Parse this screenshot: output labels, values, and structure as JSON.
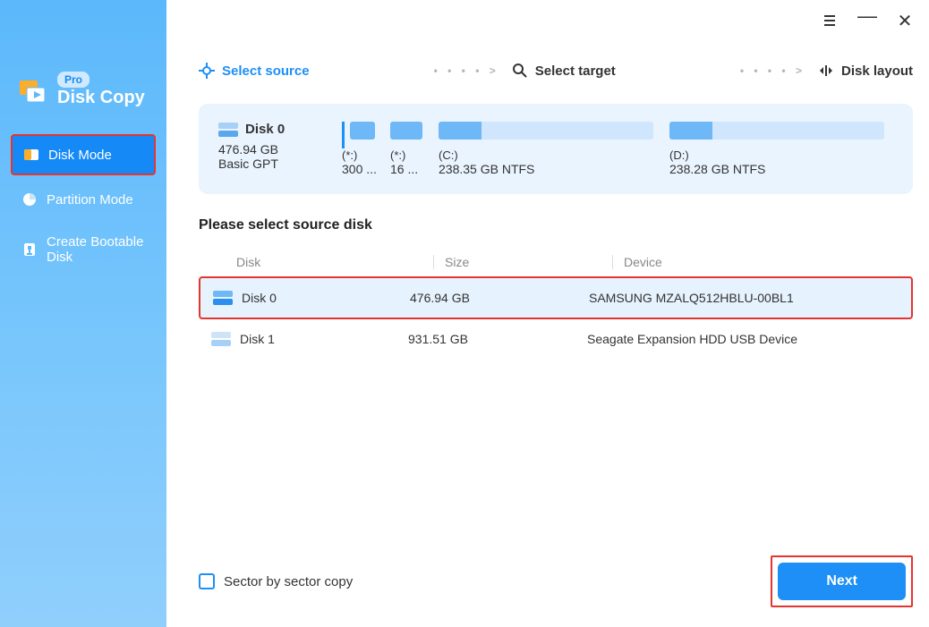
{
  "brand": {
    "name": "Disk Copy",
    "badge": "Pro"
  },
  "nav": {
    "items": [
      {
        "label": "Disk Mode",
        "active": true
      },
      {
        "label": "Partition Mode",
        "active": false
      },
      {
        "label": "Create Bootable Disk",
        "active": false
      }
    ]
  },
  "steps": {
    "source": {
      "label": "Select source",
      "active": true
    },
    "target": {
      "label": "Select target",
      "active": false
    },
    "layout": {
      "label": "Disk layout",
      "active": false
    },
    "sep": "• • • • >"
  },
  "selected_disk": {
    "name": "Disk 0",
    "size": "476.94 GB",
    "type": "Basic GPT",
    "partitions": [
      {
        "drive": "(*:)",
        "size": "300 ...",
        "fill_pct": 100
      },
      {
        "drive": "(*:)",
        "size": "16 ...",
        "fill_pct": 100
      },
      {
        "drive": "(C:)",
        "size": "238.35 GB NTFS",
        "fill_pct": 20
      },
      {
        "drive": "(D:)",
        "size": "238.28 GB NTFS",
        "fill_pct": 20
      }
    ]
  },
  "list": {
    "title": "Please select source disk",
    "headers": {
      "disk": "Disk",
      "size": "Size",
      "device": "Device"
    },
    "rows": [
      {
        "name": "Disk 0",
        "size": "476.94 GB",
        "device": "SAMSUNG MZALQ512HBLU-00BL1",
        "selected": true
      },
      {
        "name": "Disk 1",
        "size": "931.51 GB",
        "device": "Seagate  Expansion HDD   USB Device",
        "selected": false
      }
    ]
  },
  "footer": {
    "sector_copy_label": "Sector by sector copy",
    "sector_copy_checked": false,
    "next_label": "Next"
  }
}
